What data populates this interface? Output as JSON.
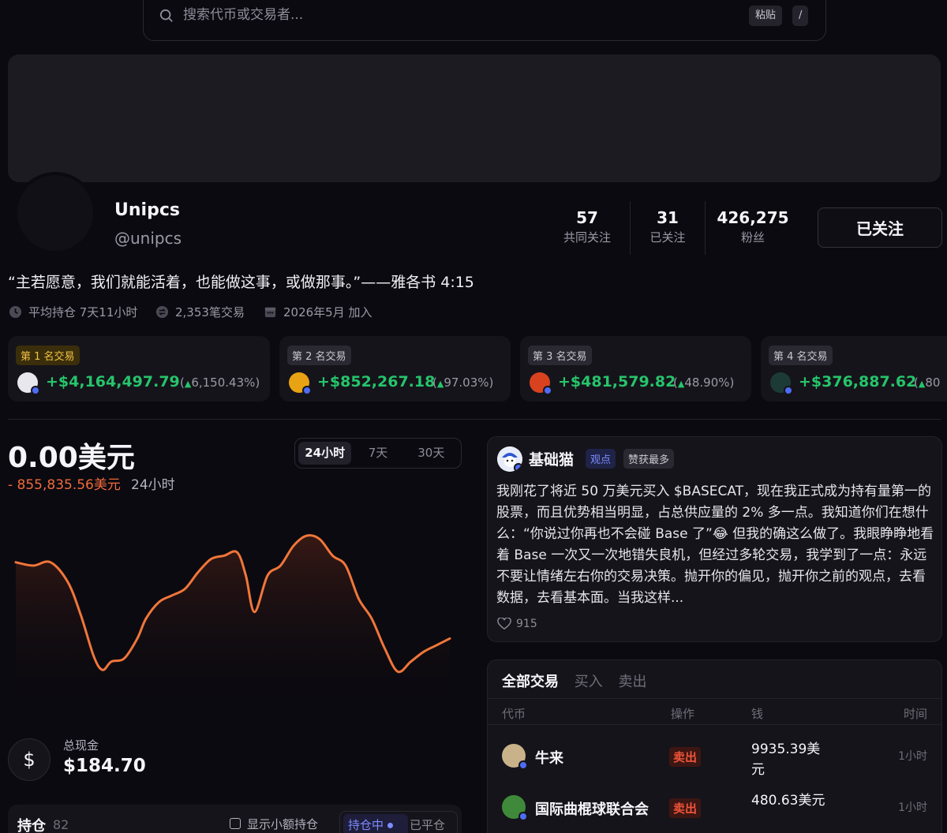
{
  "search": {
    "placeholder": "搜索代币或交易者...",
    "paste_label": "粘贴",
    "shortcut": "/"
  },
  "profile": {
    "name": "Unipcs",
    "handle": "@unipcs",
    "bio": "“主若愿意，我们就能活着，也能做这事，或做那事。”——雅各书 4:15",
    "stats": [
      {
        "value": "57",
        "label": "共同关注"
      },
      {
        "value": "31",
        "label": "已关注"
      },
      {
        "value": "426,275",
        "label": "粉丝"
      }
    ],
    "follow_label": "已关注",
    "meta": {
      "avg_hold": "平均持仓 7天11小时",
      "trades": "2,353笔交易",
      "joined": "2026年5月 加入"
    }
  },
  "top_trades": [
    {
      "rank": "第 1 名交易",
      "value": "+$4,164,497.79",
      "pct": "6,150.43%",
      "coin_color": "#e9e7ee",
      "gold": true
    },
    {
      "rank": "第 2 名交易",
      "value": "+$852,267.18",
      "pct": "97.03%",
      "coin_color": "#e7a313",
      "gold": false
    },
    {
      "rank": "第 3 名交易",
      "value": "+$481,579.82",
      "pct": "48.90%",
      "coin_color": "#d9421f",
      "gold": false
    },
    {
      "rank": "第 4 名交易",
      "value": "+$376,887.62",
      "pct": "80",
      "coin_color": "#1d3b36",
      "gold": false
    }
  ],
  "pnl": {
    "value": "0.00美元",
    "delta": "- 855,835.56美元",
    "period": "24小时",
    "ranges": [
      "24小时",
      "7天",
      "30天"
    ]
  },
  "chart_data": {
    "type": "area",
    "x": [
      0,
      4,
      8,
      12,
      15,
      18,
      20,
      22,
      25,
      28,
      30,
      33,
      36,
      39,
      42,
      45,
      48,
      51,
      53,
      55,
      58,
      61,
      64,
      67,
      70,
      73,
      76,
      79,
      82,
      85,
      88,
      91,
      94,
      97,
      100
    ],
    "values": [
      0.82,
      0.8,
      0.82,
      0.7,
      0.5,
      0.25,
      0.17,
      0.22,
      0.24,
      0.36,
      0.48,
      0.58,
      0.62,
      0.66,
      0.76,
      0.84,
      0.86,
      0.88,
      0.74,
      0.52,
      0.74,
      0.8,
      0.92,
      0.98,
      0.96,
      0.86,
      0.8,
      0.6,
      0.48,
      0.3,
      0.16,
      0.22,
      0.28,
      0.32,
      0.36
    ],
    "ylim": [
      0,
      1
    ],
    "grid": false,
    "color": "#f0763a"
  },
  "cash": {
    "label": "总现金",
    "value": "$184.70"
  },
  "holdings": {
    "title": "持仓",
    "count": "82",
    "small_label": "显示小额持仓",
    "active_tab": "持仓中",
    "other_tab": "已平仓"
  },
  "post": {
    "author": "基础猫",
    "tag_view": "观点",
    "tag_top": "赞获最多",
    "body": "我刚花了将近 50 万美元买入 $BASECAT，现在我正式成为持有量第一的股票，而且优势相当明显，占总供应量的 2% 多一点。我知道你们在想什么：“你说过你再也不会碰 Base 了”😂 但我的确这么做了。我眼睁睁地看着 Base 一次又一次地错失良机，但经过多轮交易，我学到了一点：永远不要让情绪左右你的交易决策。抛开你的偏见，抛开你之前的观点，去看数据，去看基本面。当我这样...",
    "likes": "915"
  },
  "trades": {
    "tabs": [
      "全部交易",
      "买入",
      "卖出"
    ],
    "headers": {
      "coin": "代币",
      "action": "操作",
      "amount": "钱",
      "time": "时间"
    },
    "rows": [
      {
        "name": "牛来",
        "action": "卖出",
        "amount": "9935.39美元",
        "time": "1小时",
        "coin_color": "#c9b28a"
      },
      {
        "name": "国际曲棍球联合会",
        "action": "卖出",
        "amount": "480.63美元",
        "time": "1小时",
        "coin_color": "#3f8a3a"
      }
    ]
  },
  "colors": {
    "positive": "#26c46b",
    "negative": "#f06a3a",
    "accent": "#7d8cff"
  }
}
